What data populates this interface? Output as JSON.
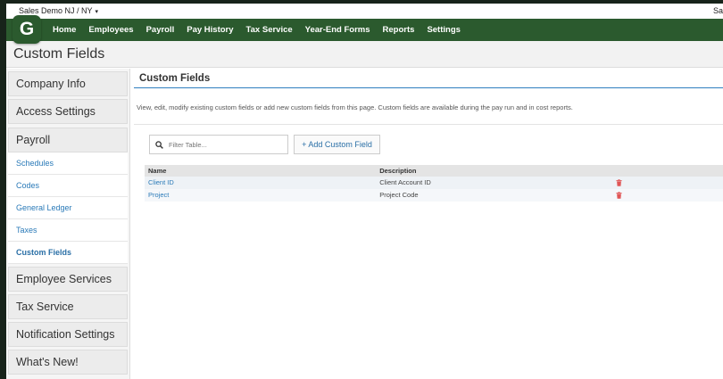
{
  "company": {
    "name": "Sales Demo NJ / NY",
    "caret": "▾",
    "user_fragment": "Sa"
  },
  "logo": {
    "letter": "G"
  },
  "nav": {
    "items": [
      "Home",
      "Employees",
      "Payroll",
      "Pay History",
      "Tax Service",
      "Year-End Forms",
      "Reports",
      "Settings"
    ]
  },
  "page_title": "Custom Fields",
  "sidebar": {
    "sections": [
      "Company Info",
      "Access Settings",
      "Payroll"
    ],
    "payroll_items": [
      "Schedules",
      "Codes",
      "General Ledger",
      "Taxes",
      "Custom Fields"
    ],
    "sections_after": [
      "Employee Services",
      "Tax Service",
      "Notification Settings",
      "What's New!"
    ]
  },
  "main": {
    "header": "Custom Fields",
    "description": "View, edit, modify existing custom fields or add new custom fields from this page. Custom fields are available during the pay run and in cost reports.",
    "search_placeholder": "Filter Table...",
    "add_button": "+ Add Custom Field",
    "table": {
      "columns": [
        "Name",
        "Description"
      ],
      "rows": [
        {
          "name": "Client ID",
          "description": "Client Account ID"
        },
        {
          "name": "Project",
          "description": "Project Code"
        }
      ]
    }
  },
  "colors": {
    "nav_green": "#2b5a2e",
    "link_blue": "#2a7ab8",
    "trash_red": "#e05555"
  },
  "icons": {
    "search": "search-icon",
    "trash": "trash-icon"
  }
}
